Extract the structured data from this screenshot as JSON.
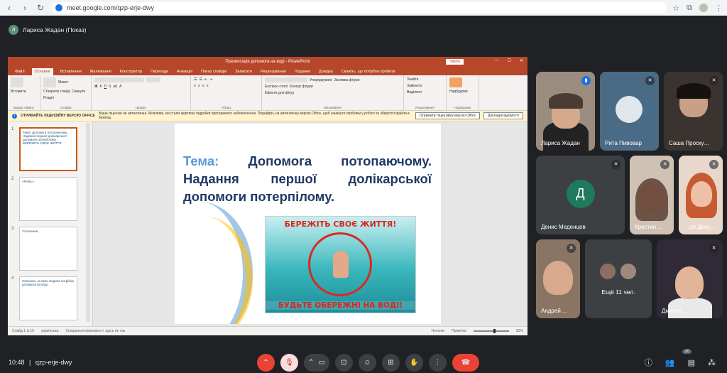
{
  "browser": {
    "url": "meet.google.com/qzp-erje-dwy"
  },
  "meet": {
    "presenter_label": "Лариса Жадан (Показ)",
    "presenter_initial": "Л",
    "time": "10:48",
    "meeting_code": "qzp-erje-dwy",
    "participants_count": "20"
  },
  "powerpoint": {
    "window_title": "Презентація  допомога на воді  -  PowerPoint",
    "login": "Увійти",
    "tabs": [
      "Файл",
      "Основне",
      "Вставлення",
      "Малювання",
      "Конструктор",
      "Переходи",
      "Анімація",
      "Показ слайдів",
      "Записати",
      "Рецензування",
      "Подання",
      "Довідка",
      "Скажіть, що потрібно зробити"
    ],
    "ribbon": {
      "paste": "Вставити",
      "new_slide": "Створити слайд",
      "layout": "Макет",
      "reset": "Скинути",
      "sections": "Розділ",
      "arrange": "Упорядкувати",
      "styles": "Експрес-стилі",
      "fill": "Заливка фігури",
      "outline": "Контур фігури",
      "effects": "Ефекти для фігур",
      "find": "Знайти",
      "replace": "Замінити",
      "select": "Виділити",
      "addins": "Надбудови",
      "groups": [
        "Буфер обміну",
        "Слайди",
        "Шрифт",
        "Абзац",
        "Малювання",
        "Редагування",
        "Надбудови"
      ]
    },
    "license": {
      "title": "ОТРИМАЙТЕ ЛІЦЕНЗІЙНУ ВЕРСІЮ OFFICE",
      "message": "Ваша ліцензія не автентична. Можливо, ви стали жертвою підробки програмного забезпечення. Перейдіть на автентичну версію Office, щоб уникнути проблем у роботі та зберегти файли в безпеці.",
      "btn_get": "Отримати ліцензійну версію Office",
      "btn_more": "Докладні відомості"
    },
    "thumbs": [
      {
        "num": "1",
        "text": "Тема: Допомога потопаючому. Надання першої долікарської допомоги потерпілому. БЕРЕЖІТЬ СВОЄ ЖИТТЯ"
      },
      {
        "num": "2",
        "text": "«Ребус»"
      },
      {
        "num": "3",
        "text": "Утоплення"
      },
      {
        "num": "4",
        "text": "Спасіння, за яких людина потрібна допомога на воді:"
      }
    ],
    "slide": {
      "tema": "Тема:",
      "title": "Допомога потопаючому. Надання першої долікарської допомоги потерпілому.",
      "poster_top": "БЕРЕЖІТЬ СВОЄ ЖИТТЯ!",
      "poster_bottom": "БУДЬТЕ ОБЕРЕЖНІ НА ВОДІ!"
    },
    "status": {
      "slide": "Слайд 1 із 19",
      "lang": "українська",
      "access": "Спеціальні можливості: щось не так",
      "notes": "Нотатки",
      "comments": "Примітки",
      "zoom": "82%"
    }
  },
  "participants": [
    {
      "name": "Лариса Жадан",
      "speaking": true
    },
    {
      "name": "Рита Пивовар"
    },
    {
      "name": "Саша Проску…"
    },
    {
      "name": "Денис Меденцев",
      "initial": "Д"
    },
    {
      "name": "Кристин…"
    },
    {
      "name": "…ая Дроз…"
    },
    {
      "name": "Андрей …"
    },
    {
      "name": "Ещё 11 чел."
    },
    {
      "name": "Дмитро…"
    }
  ]
}
